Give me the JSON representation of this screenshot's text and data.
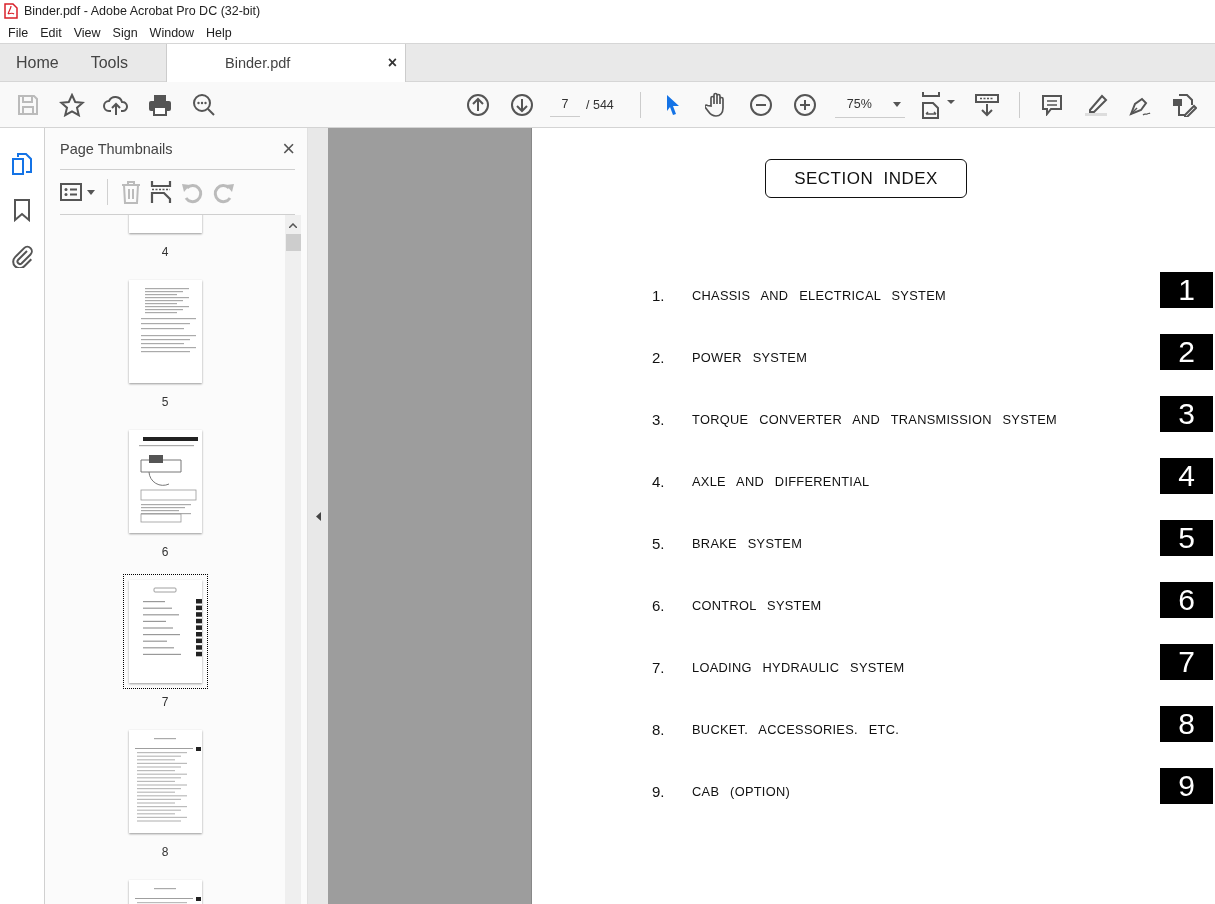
{
  "window": {
    "title": "Binder.pdf - Adobe Acrobat Pro DC (32-bit)"
  },
  "menu": [
    "File",
    "Edit",
    "View",
    "Sign",
    "Window",
    "Help"
  ],
  "tabs": [
    {
      "label": "Home",
      "selected": false
    },
    {
      "label": "Tools",
      "selected": false
    },
    {
      "label": "Binder.pdf",
      "selected": true,
      "close": "×"
    }
  ],
  "toolbar": {
    "page": "7",
    "total": "/ 544",
    "zoom": "75%",
    "save_disabled": true
  },
  "nav": [
    {
      "kind": "pages",
      "selected": true
    },
    {
      "kind": "bookmark",
      "selected": false
    },
    {
      "kind": "attachment",
      "selected": false
    }
  ],
  "panel": {
    "title": "Page Thumbnails",
    "close": "×",
    "thumbnails": [
      {
        "label": "4",
        "kind": "text",
        "selected": false
      },
      {
        "label": "5",
        "kind": "text",
        "selected": false
      },
      {
        "label": "6",
        "kind": "diagram",
        "selected": false
      },
      {
        "label": "7",
        "kind": "index",
        "selected": true
      },
      {
        "label": "8",
        "kind": "table",
        "selected": false
      },
      {
        "kind": "table",
        "selected": false
      }
    ]
  },
  "document": {
    "title": "SECTION INDEX",
    "sections": [
      {
        "number": "1.",
        "title": "CHASSIS AND ELECTRICAL SYSTEM",
        "tab": "1"
      },
      {
        "number": "2.",
        "title": "POWER SYSTEM",
        "tab": "2"
      },
      {
        "number": "3.",
        "title": "TORQUE CONVERTER AND TRANSMISSION SYSTEM",
        "tab": "3"
      },
      {
        "number": "4.",
        "title": "AXLE AND DIFFERENTIAL",
        "tab": "4"
      },
      {
        "number": "5.",
        "title": "BRAKE SYSTEM",
        "tab": "5"
      },
      {
        "number": "6.",
        "title": "CONTROL SYSTEM",
        "tab": "6"
      },
      {
        "number": "7.",
        "title": "LOADING HYDRAULIC SYSTEM",
        "tab": "7"
      },
      {
        "number": "8.",
        "title": "BUCKET. ACCESSORIES. ETC.",
        "tab": "8"
      },
      {
        "number": "9.",
        "title": "CAB (OPTION)",
        "tab": "9"
      }
    ]
  }
}
